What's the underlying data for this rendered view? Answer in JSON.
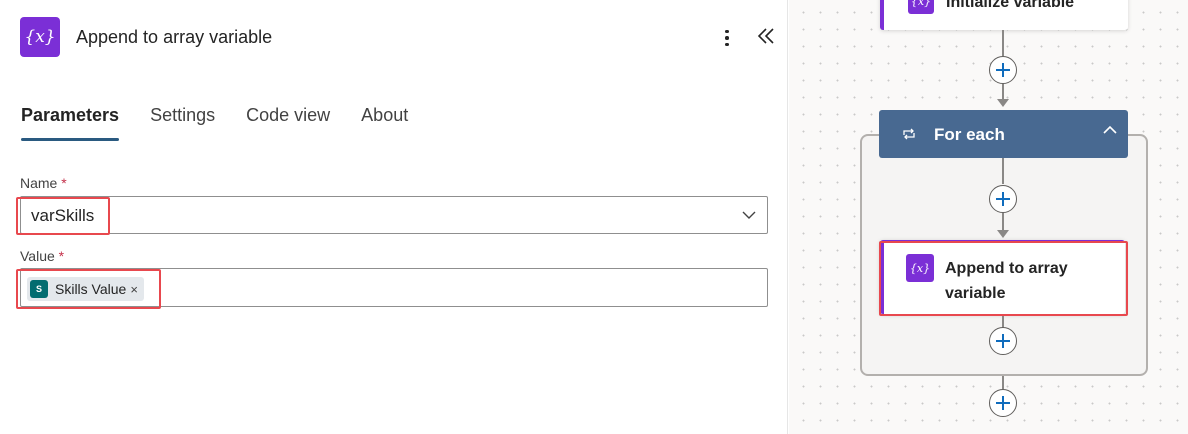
{
  "panel": {
    "title": "Append to array variable",
    "icon": "variable-icon",
    "icon_text": "{x}",
    "accent_color": "#7b2fd6",
    "tabs": [
      {
        "label": "Parameters",
        "active": true
      },
      {
        "label": "Settings",
        "active": false
      },
      {
        "label": "Code view",
        "active": false
      },
      {
        "label": "About",
        "active": false
      }
    ],
    "fields": {
      "name": {
        "label": "Name",
        "required_mark": "*",
        "value": "varSkills"
      },
      "value": {
        "label": "Value",
        "required_mark": "*",
        "token": {
          "label": "Skills Value",
          "remove": "×",
          "icon_text": "S",
          "icon_color": "#036c70"
        }
      }
    }
  },
  "canvas": {
    "init_card": {
      "title": "Initialize variable",
      "icon_text": "{x}"
    },
    "foreach": {
      "title": "For each",
      "color": "#486991"
    },
    "append_card": {
      "title": "Append to array variable",
      "icon_text": "{x}"
    }
  },
  "highlight_color": "#e8484e"
}
